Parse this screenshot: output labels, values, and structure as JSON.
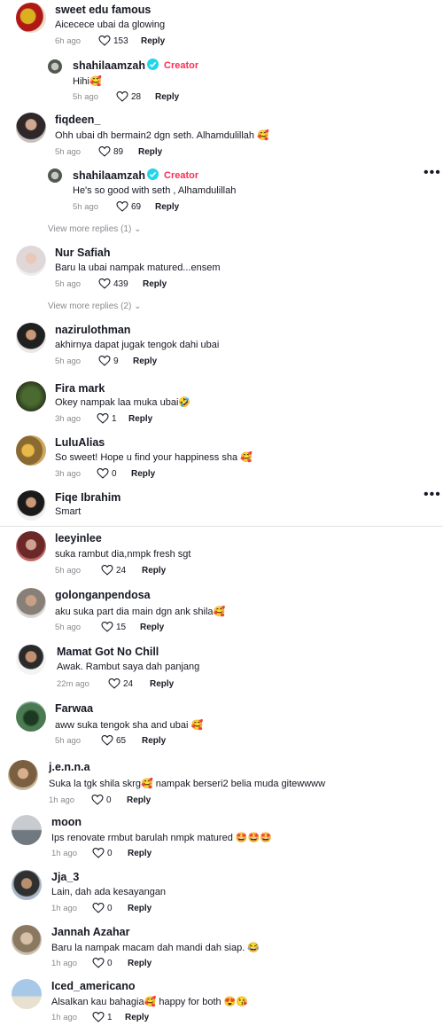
{
  "colors": {
    "creator": "#fe2c55",
    "muted": "#8a8b91",
    "verified": "#20d5ec"
  },
  "comments": [
    {
      "name": "sweet edu famous",
      "text": "Aicecece ubai da glowing",
      "time": "6h ago",
      "likes": "153",
      "reply": "Reply"
    },
    {
      "name": "shahilaamzah",
      "creator": "Creator",
      "text": "Hihi",
      "emoji": "🥰",
      "time": "5h ago",
      "likes": "28",
      "reply": "Reply"
    },
    {
      "name": "fiqdeen_",
      "text": "Ohh ubai dh bermain2 dgn seth. Alhamdulillah",
      "emoji": "🥰",
      "time": "5h ago",
      "likes": "89",
      "reply": "Reply"
    },
    {
      "name": "shahilaamzah",
      "creator": "Creator",
      "text": "He's so good with seth , Alhamdulillah",
      "time": "5h ago",
      "likes": "69",
      "reply": "Reply"
    },
    {
      "name": "Nur Safiah",
      "text": "Baru la ubai nampak matured...ensem",
      "time": "5h ago",
      "likes": "439",
      "reply": "Reply"
    },
    {
      "name": "nazirulothman",
      "text": "akhirnya dapat jugak tengok dahi ubai",
      "time": "5h ago",
      "likes": "9",
      "reply": "Reply"
    },
    {
      "name": "Fira mark",
      "text": "Okey nampak laa muka ubai",
      "emoji": "🤣",
      "time": "3h ago",
      "likes": "1",
      "reply": "Reply"
    },
    {
      "name": "LuluAlias",
      "text": "So sweet! Hope u find your happiness sha",
      "emoji": "🥰",
      "time": "3h ago",
      "likes": "0",
      "reply": "Reply"
    },
    {
      "name": "Fiqe Ibrahim",
      "text": "Smart"
    },
    {
      "name": "leeyinlee",
      "text": "suka rambut dia,nmpk fresh sgt",
      "time": "5h ago",
      "likes": "24",
      "reply": "Reply"
    },
    {
      "name": "golonganpendosa",
      "text": "aku suka part dia main dgn ank shila",
      "emoji": "🥰",
      "time": "5h ago",
      "likes": "15",
      "reply": "Reply"
    },
    {
      "name": "Mamat Got No Chill",
      "text": "Awak. Rambut saya dah panjang",
      "time": "22m ago",
      "likes": "24",
      "reply": "Reply"
    },
    {
      "name": "Farwaa",
      "text": "aww suka tengok sha and ubai",
      "emoji": "🥰",
      "time": "5h ago",
      "likes": "65",
      "reply": "Reply"
    },
    {
      "name": "j.e.n.n.a",
      "text": "Suka la tgk shila skrg",
      "emoji": "🥰",
      "text2": " nampak berseri2 belia muda gitewwww",
      "time": "1h ago",
      "likes": "0",
      "reply": "Reply"
    },
    {
      "name": "moon",
      "text": "Ips renovate rmbut barulah nmpk matured",
      "emoji": "🤩🤩🤩",
      "time": "1h ago",
      "likes": "0",
      "reply": "Reply"
    },
    {
      "name": "Jja_3",
      "text": "Lain, dah ada kesayangan",
      "time": "1h ago",
      "likes": "0",
      "reply": "Reply"
    },
    {
      "name": "Jannah Azahar",
      "text": "Baru la nampak macam dah mandi dah siap.",
      "emoji": "😂",
      "time": "1h ago",
      "likes": "0",
      "reply": "Reply"
    },
    {
      "name": "Iced_americano",
      "text": "Alsalkan kau bahagia",
      "emoji": "🥰",
      "text2": " happy for both",
      "emoji2": "😍😘",
      "time": "1h ago",
      "likes": "1",
      "reply": "Reply"
    }
  ],
  "view_more": [
    "View more replies (1)",
    "View more replies (2)"
  ]
}
